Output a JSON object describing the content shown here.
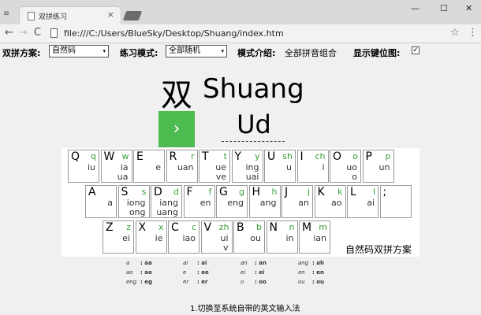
{
  "browser": {
    "tab_title": "双拼练习",
    "tab_close": "×",
    "address": "file:///C:/Users/BlueSky/Desktop/Shuang/index.htm",
    "controls": {
      "minimize": "—",
      "maximize": "☐",
      "close": "✕"
    },
    "nav": {
      "back": "←",
      "forward": "→",
      "reload": "C"
    },
    "icons": {
      "window": "≡",
      "star": "☆",
      "menu": "⋮"
    }
  },
  "settings": {
    "scheme_label": "双拼方案:",
    "scheme_value": "自然码",
    "mode_label": "练习模式:",
    "mode_value": "全部随机",
    "intro_label": "模式介绍:",
    "intro_value": "全部拼音组合",
    "show_key_label": "显示键位图:",
    "show_key_checked": "✓",
    "select_arrow": "▾"
  },
  "quiz": {
    "hanzi": "双",
    "pinyin": "Shuang",
    "button_glyph": "›",
    "answer": "Ud"
  },
  "keyboard": {
    "caption": "自然码双拼方案",
    "row1": [
      {
        "k": "Q",
        "s": "q",
        "a": "iu",
        "b": ""
      },
      {
        "k": "W",
        "s": "w",
        "a": "ia",
        "b": "ua"
      },
      {
        "k": "E",
        "s": "",
        "a": "e",
        "b": ""
      },
      {
        "k": "R",
        "s": "r",
        "a": "uan",
        "b": ""
      },
      {
        "k": "T",
        "s": "t",
        "a": "ue",
        "b": "ve"
      },
      {
        "k": "Y",
        "s": "y",
        "a": "ing",
        "b": "uai"
      },
      {
        "k": "U",
        "s": "sh",
        "a": "u",
        "b": ""
      },
      {
        "k": "I",
        "s": "ch",
        "a": "i",
        "b": ""
      },
      {
        "k": "O",
        "s": "o",
        "a": "uo",
        "b": "o"
      },
      {
        "k": "P",
        "s": "p",
        "a": "un",
        "b": ""
      }
    ],
    "row2": [
      {
        "k": "A",
        "s": "",
        "a": "a",
        "b": ""
      },
      {
        "k": "S",
        "s": "s",
        "a": "iong",
        "b": "ong"
      },
      {
        "k": "D",
        "s": "d",
        "a": "iang",
        "b": "uang"
      },
      {
        "k": "F",
        "s": "f",
        "a": "en",
        "b": ""
      },
      {
        "k": "G",
        "s": "g",
        "a": "eng",
        "b": ""
      },
      {
        "k": "H",
        "s": "h",
        "a": "ang",
        "b": ""
      },
      {
        "k": "J",
        "s": "j",
        "a": "an",
        "b": ""
      },
      {
        "k": "K",
        "s": "k",
        "a": "ao",
        "b": ""
      },
      {
        "k": "L",
        "s": "l",
        "a": "ai",
        "b": ""
      },
      {
        "k": ";",
        "s": "",
        "a": "",
        "b": ""
      }
    ],
    "row3": [
      {
        "k": "Z",
        "s": "z",
        "a": "ei",
        "b": ""
      },
      {
        "k": "X",
        "s": "x",
        "a": "ie",
        "b": ""
      },
      {
        "k": "C",
        "s": "c",
        "a": "iao",
        "b": ""
      },
      {
        "k": "V",
        "s": "zh",
        "a": "ui",
        "b": "v"
      },
      {
        "k": "B",
        "s": "b",
        "a": "ou",
        "b": ""
      },
      {
        "k": "N",
        "s": "n",
        "a": "in",
        "b": ""
      },
      {
        "k": "M",
        "s": "m",
        "a": "ian",
        "b": ""
      }
    ]
  },
  "zero_initial_table": [
    [
      {
        "p": "a",
        "c": "aa"
      },
      {
        "p": "ai",
        "c": "ai"
      },
      {
        "p": "an",
        "c": "an"
      },
      {
        "p": "ang",
        "c": "ah"
      }
    ],
    [
      {
        "p": "ao",
        "c": "ao"
      },
      {
        "p": "e",
        "c": "ee"
      },
      {
        "p": "ei",
        "c": "ei"
      },
      {
        "p": "en",
        "c": "en"
      }
    ],
    [
      {
        "p": "eng",
        "c": "eg"
      },
      {
        "p": "er",
        "c": "er"
      },
      {
        "p": "o",
        "c": "oo"
      },
      {
        "p": "ou",
        "c": "ou"
      }
    ]
  ],
  "hint": "1.切换至系统自带的英文输入法"
}
